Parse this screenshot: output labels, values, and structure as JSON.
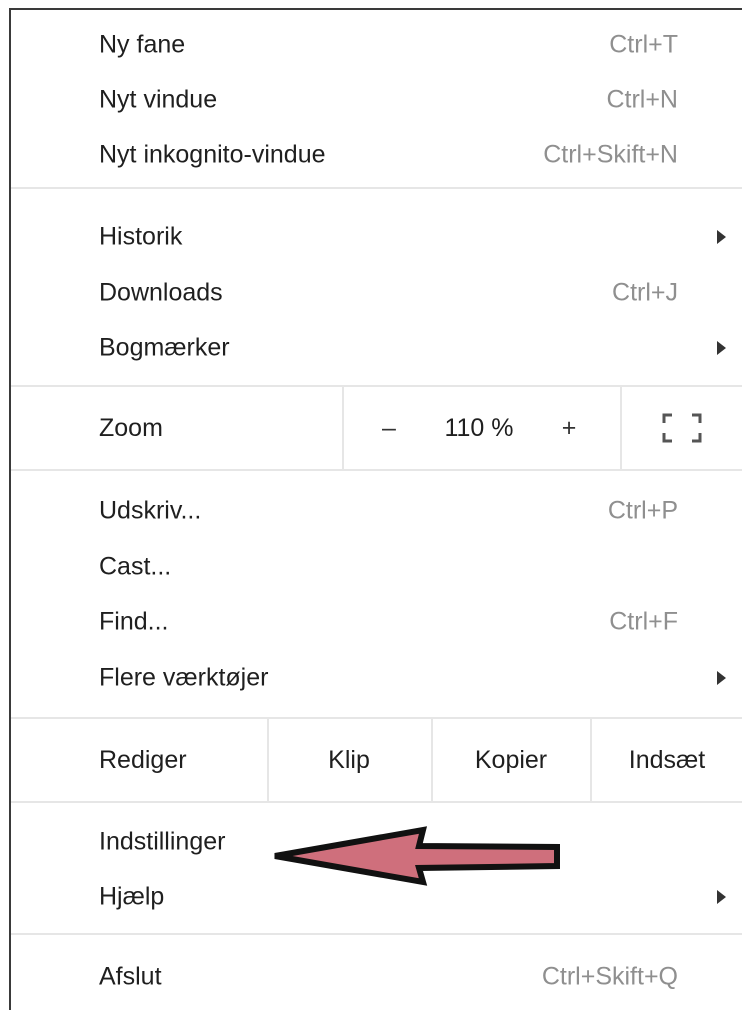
{
  "menu": {
    "group1": [
      {
        "label": "Ny fane",
        "shortcut": "Ctrl+T"
      },
      {
        "label": "Nyt vindue",
        "shortcut": "Ctrl+N"
      },
      {
        "label": "Nyt inkognito-vindue",
        "shortcut": "Ctrl+Skift+N"
      }
    ],
    "group2": [
      {
        "label": "Historik",
        "submenu": true
      },
      {
        "label": "Downloads",
        "shortcut": "Ctrl+J"
      },
      {
        "label": "Bogmærker",
        "submenu": true
      }
    ],
    "zoom": {
      "label": "Zoom",
      "minus": "–",
      "value": "110 %",
      "plus": "+",
      "fullscreen_icon": "fullscreen-icon"
    },
    "group3": [
      {
        "label": "Udskriv...",
        "shortcut": "Ctrl+P"
      },
      {
        "label": "Cast..."
      },
      {
        "label": "Find...",
        "shortcut": "Ctrl+F"
      },
      {
        "label": "Flere værktøjer",
        "submenu": true
      }
    ],
    "edit": {
      "label": "Rediger",
      "cut": "Klip",
      "copy": "Kopier",
      "paste": "Indsæt"
    },
    "group4": [
      {
        "label": "Indstillinger"
      },
      {
        "label": "Hjælp",
        "submenu": true
      }
    ],
    "exit": {
      "label": "Afslut",
      "shortcut": "Ctrl+Skift+Q"
    }
  },
  "annotation": {
    "icon": "left-arrow-icon",
    "fill_color": "#cf6f7c",
    "stroke_color": "#111111"
  },
  "colors": {
    "separator": "#e6e6e6",
    "shortcut_text": "#8f8f8f"
  }
}
